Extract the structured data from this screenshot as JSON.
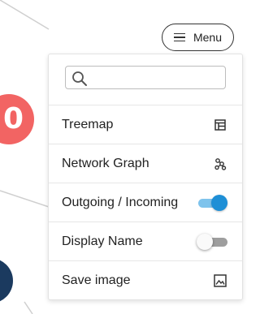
{
  "menu_button": {
    "label": "Menu",
    "icon": "hamburger-icon"
  },
  "search": {
    "placeholder": "",
    "value": ""
  },
  "items": [
    {
      "label": "Treemap",
      "icon": "treemap-icon"
    },
    {
      "label": "Network Graph",
      "icon": "network-graph-icon"
    },
    {
      "label": "Outgoing / Incoming",
      "control": "toggle",
      "on": true
    },
    {
      "label": "Display Name",
      "control": "toggle",
      "on": false
    },
    {
      "label": "Save image",
      "icon": "image-icon"
    }
  ],
  "background": {
    "node_label": "0",
    "node_colors": {
      "red": "#f26463",
      "navy": "#1b3a5f"
    },
    "edge_color": "#cfcfcf"
  },
  "colors": {
    "toggle_on_thumb": "#1e8fd6",
    "toggle_on_track": "#7ec3ec",
    "toggle_off_track": "#9e9e9e"
  }
}
